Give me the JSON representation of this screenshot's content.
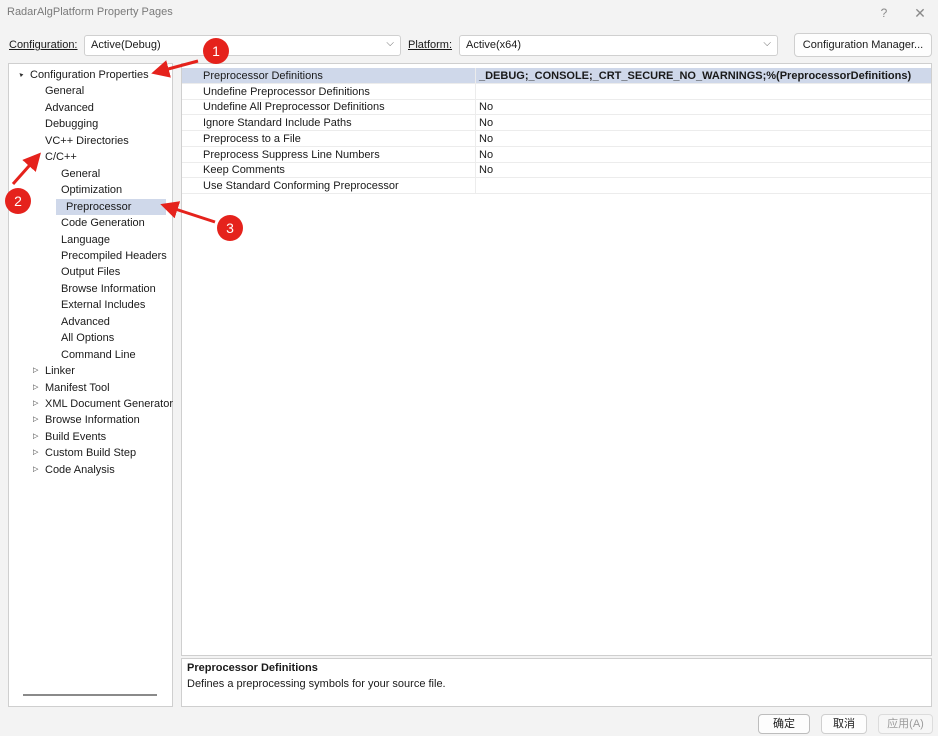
{
  "window": {
    "title": "RadarAlgPlatform Property Pages",
    "help_glyph": "?",
    "close_glyph": "✕"
  },
  "toolbar": {
    "configuration_label": "Configuration:",
    "configuration_value": "Active(Debug)",
    "platform_label": "Platform:",
    "platform_value": "Active(x64)",
    "configuration_manager_label": "Configuration Manager..."
  },
  "tree": {
    "items": [
      {
        "label": "Configuration Properties",
        "level": 0,
        "expander": "expanded"
      },
      {
        "label": "General",
        "level": 1
      },
      {
        "label": "Advanced",
        "level": 1
      },
      {
        "label": "Debugging",
        "level": 1
      },
      {
        "label": "VC++ Directories",
        "level": 1
      },
      {
        "label": "C/C++",
        "level": 1,
        "expander": "expanded"
      },
      {
        "label": "General",
        "level": 2
      },
      {
        "label": "Optimization",
        "level": 2
      },
      {
        "label": "Preprocessor",
        "level": 2,
        "selected": true
      },
      {
        "label": "Code Generation",
        "level": 2
      },
      {
        "label": "Language",
        "level": 2
      },
      {
        "label": "Precompiled Headers",
        "level": 2
      },
      {
        "label": "Output Files",
        "level": 2
      },
      {
        "label": "Browse Information",
        "level": 2
      },
      {
        "label": "External Includes",
        "level": 2
      },
      {
        "label": "Advanced",
        "level": 2
      },
      {
        "label": "All Options",
        "level": 2
      },
      {
        "label": "Command Line",
        "level": 2
      },
      {
        "label": "Linker",
        "level": 1,
        "expander": "collapsed"
      },
      {
        "label": "Manifest Tool",
        "level": 1,
        "expander": "collapsed"
      },
      {
        "label": "XML Document Generator",
        "level": 1,
        "expander": "collapsed"
      },
      {
        "label": "Browse Information",
        "level": 1,
        "expander": "collapsed"
      },
      {
        "label": "Build Events",
        "level": 1,
        "expander": "collapsed"
      },
      {
        "label": "Custom Build Step",
        "level": 1,
        "expander": "collapsed"
      },
      {
        "label": "Code Analysis",
        "level": 1,
        "expander": "collapsed"
      }
    ]
  },
  "properties": {
    "rows": [
      {
        "name": "Preprocessor Definitions",
        "value": "_DEBUG;_CONSOLE;_CRT_SECURE_NO_WARNINGS;%(PreprocessorDefinitions)",
        "bold": true,
        "selected": true
      },
      {
        "name": "Undefine Preprocessor Definitions",
        "value": ""
      },
      {
        "name": "Undefine All Preprocessor Definitions",
        "value": "No"
      },
      {
        "name": "Ignore Standard Include Paths",
        "value": "No"
      },
      {
        "name": "Preprocess to a File",
        "value": "No"
      },
      {
        "name": "Preprocess Suppress Line Numbers",
        "value": "No"
      },
      {
        "name": "Keep Comments",
        "value": "No"
      },
      {
        "name": "Use Standard Conforming Preprocessor",
        "value": ""
      }
    ]
  },
  "description": {
    "title": "Preprocessor Definitions",
    "text": "Defines a preprocessing symbols for your source file."
  },
  "buttons": {
    "ok": "确定",
    "cancel": "取消",
    "apply": "应用(A)"
  },
  "annotations": {
    "badges": [
      "1",
      "2",
      "3"
    ],
    "color": "#e5221c"
  },
  "icons": {
    "expanded": "▲",
    "collapsed": "▷",
    "dropdown": "⌵"
  }
}
